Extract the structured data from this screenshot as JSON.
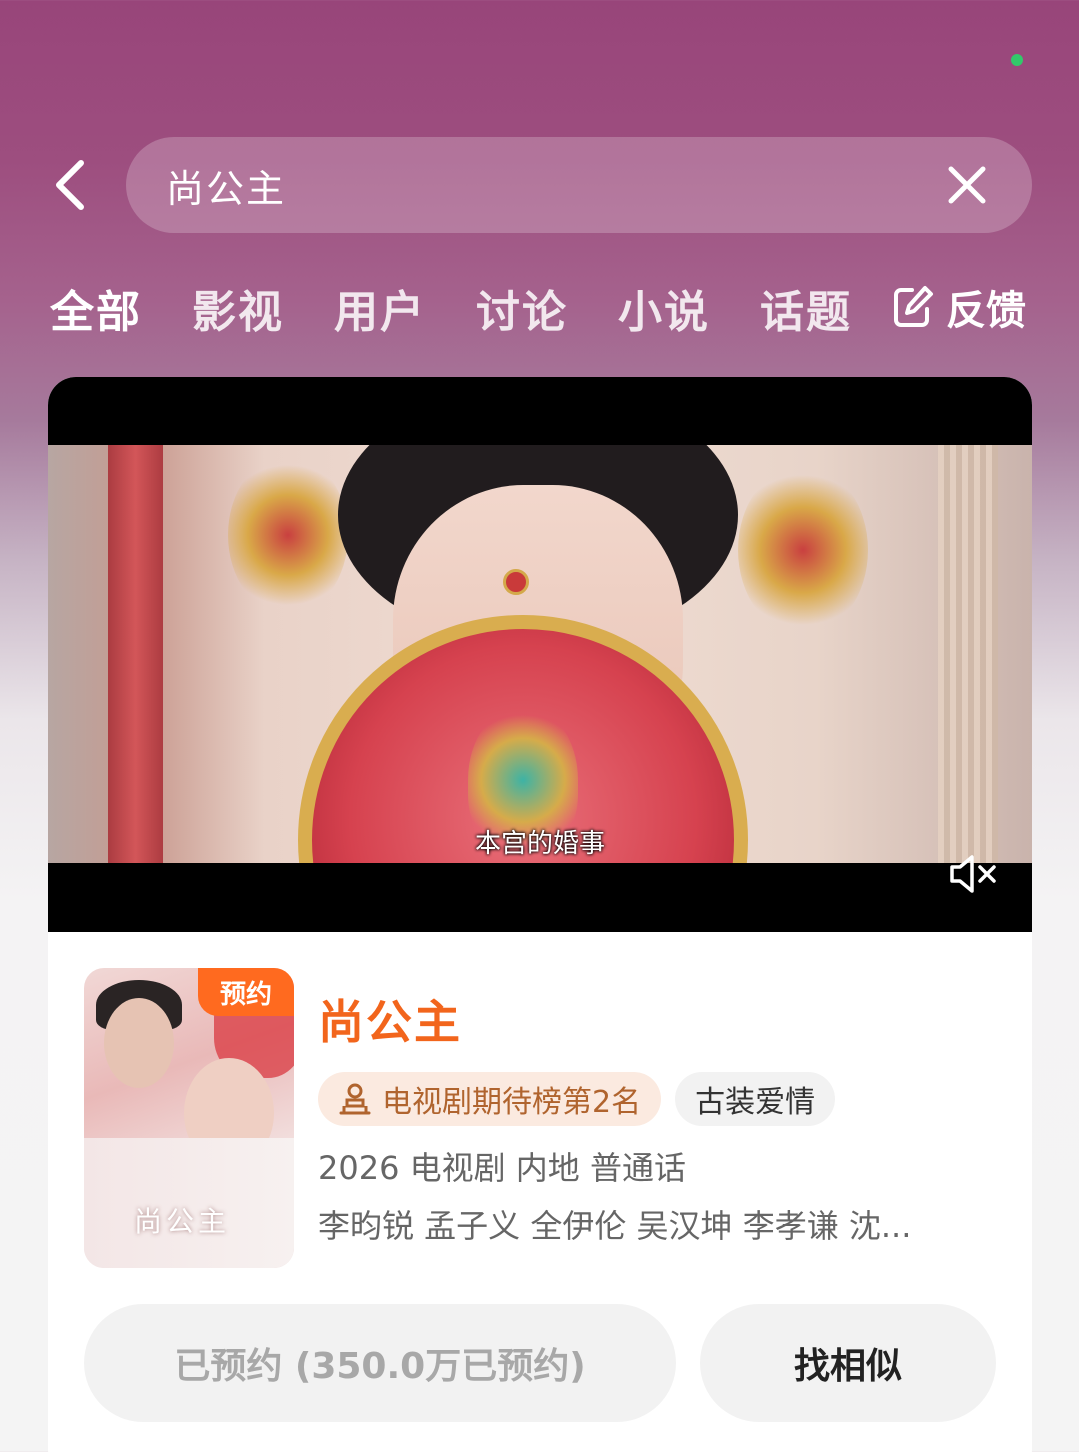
{
  "header": {
    "search_query": "尚公主"
  },
  "tabs": [
    {
      "label": "全部",
      "active": true
    },
    {
      "label": "影视",
      "active": false
    },
    {
      "label": "用户",
      "active": false
    },
    {
      "label": "讨论",
      "active": false
    },
    {
      "label": "小说",
      "active": false
    },
    {
      "label": "话题",
      "active": false
    }
  ],
  "feedback_label": "反馈",
  "video": {
    "subtitle": "本宫的婚事",
    "muted": true
  },
  "result": {
    "badge": "预约",
    "poster_title": "尚公主",
    "title": "尚公主",
    "rank_tag": "电视剧期待榜第2名",
    "genre_tag": "古装爱情",
    "meta": "2026 电视剧 内地 普通话",
    "cast": "李昀锐 孟子义 全伊伦 吴汉坤 李孝谦 沈...",
    "reserved_button": "已预约 (350.0万已预约)",
    "similar_button": "找相似"
  },
  "colors": {
    "accent_orange": "#f2651c",
    "badge_orange": "#ff6a1f",
    "rank_text": "#b0642e",
    "status_dot": "#32c86a"
  },
  "icons": [
    "back-icon",
    "clear-icon",
    "edit-icon",
    "mute-icon",
    "rank-icon"
  ]
}
